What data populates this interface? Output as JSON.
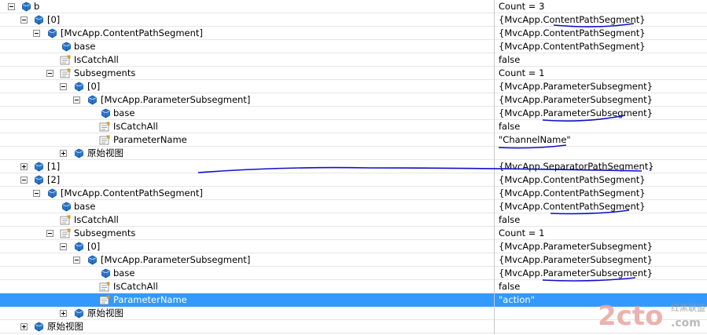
{
  "icons": {
    "field": "cube-icon",
    "property": "property-icon",
    "view": "raw-view-icon",
    "expand": "tree-expander-icon"
  },
  "colors": {
    "selection": "#3399ff",
    "annotation": "#1010c8",
    "field_icon": "#2a78d2"
  },
  "rows": [
    {
      "label": "b",
      "value": "Count = 3",
      "state": "expanded",
      "icon": "field"
    },
    {
      "label": "[0]",
      "value": "{MvcApp.ContentPathSegment}",
      "state": "expanded",
      "icon": "field"
    },
    {
      "label": "[MvcApp.ContentPathSegment]",
      "value": "{MvcApp.ContentPathSegment}",
      "state": "expanded",
      "icon": "field"
    },
    {
      "label": "base",
      "value": "{MvcApp.ContentPathSegment}",
      "state": "none",
      "icon": "field"
    },
    {
      "label": "IsCatchAll",
      "value": "false",
      "state": "none",
      "icon": "property"
    },
    {
      "label": "Subsegments",
      "value": "Count = 1",
      "state": "expanded",
      "icon": "property"
    },
    {
      "label": "[0]",
      "value": "{MvcApp.ParameterSubsegment}",
      "state": "expanded",
      "icon": "field"
    },
    {
      "label": "[MvcApp.ParameterSubsegment]",
      "value": "{MvcApp.ParameterSubsegment}",
      "state": "expanded",
      "icon": "field"
    },
    {
      "label": "base",
      "value": "{MvcApp.ParameterSubsegment}",
      "state": "none",
      "icon": "field"
    },
    {
      "label": "IsCatchAll",
      "value": "false",
      "state": "none",
      "icon": "property"
    },
    {
      "label": "ParameterName",
      "value": "\"ChannelName\"",
      "state": "none",
      "icon": "property"
    },
    {
      "label": "原始视图",
      "value": "",
      "state": "collapsed",
      "icon": "view"
    },
    {
      "label": "[1]",
      "value": "{MvcApp.SeparatorPathSegment}",
      "state": "collapsed",
      "icon": "field"
    },
    {
      "label": "[2]",
      "value": "{MvcApp.ContentPathSegment}",
      "state": "expanded",
      "icon": "field"
    },
    {
      "label": "[MvcApp.ContentPathSegment]",
      "value": "{MvcApp.ContentPathSegment}",
      "state": "expanded",
      "icon": "field"
    },
    {
      "label": "base",
      "value": "{MvcApp.ContentPathSegment}",
      "state": "none",
      "icon": "field"
    },
    {
      "label": "IsCatchAll",
      "value": "false",
      "state": "none",
      "icon": "property"
    },
    {
      "label": "Subsegments",
      "value": "Count = 1",
      "state": "expanded",
      "icon": "property"
    },
    {
      "label": "[0]",
      "value": "{MvcApp.ParameterSubsegment}",
      "state": "expanded",
      "icon": "field"
    },
    {
      "label": "[MvcApp.ParameterSubsegment]",
      "value": "{MvcApp.ParameterSubsegment}",
      "state": "expanded",
      "icon": "field"
    },
    {
      "label": "base",
      "value": "{MvcApp.ParameterSubsegment}",
      "state": "none",
      "icon": "field"
    },
    {
      "label": "IsCatchAll",
      "value": "false",
      "state": "none",
      "icon": "property"
    },
    {
      "label": "ParameterName",
      "value": "\"action\"",
      "state": "none",
      "icon": "property",
      "selected": true
    },
    {
      "label": "原始视图",
      "value": "",
      "state": "collapsed",
      "icon": "view"
    },
    {
      "label": "原始视图",
      "value": "",
      "state": "collapsed",
      "icon": "view"
    }
  ],
  "watermark": {
    "logo": "2cto",
    "suffix": ".com",
    "caption": "红黑联盟"
  }
}
